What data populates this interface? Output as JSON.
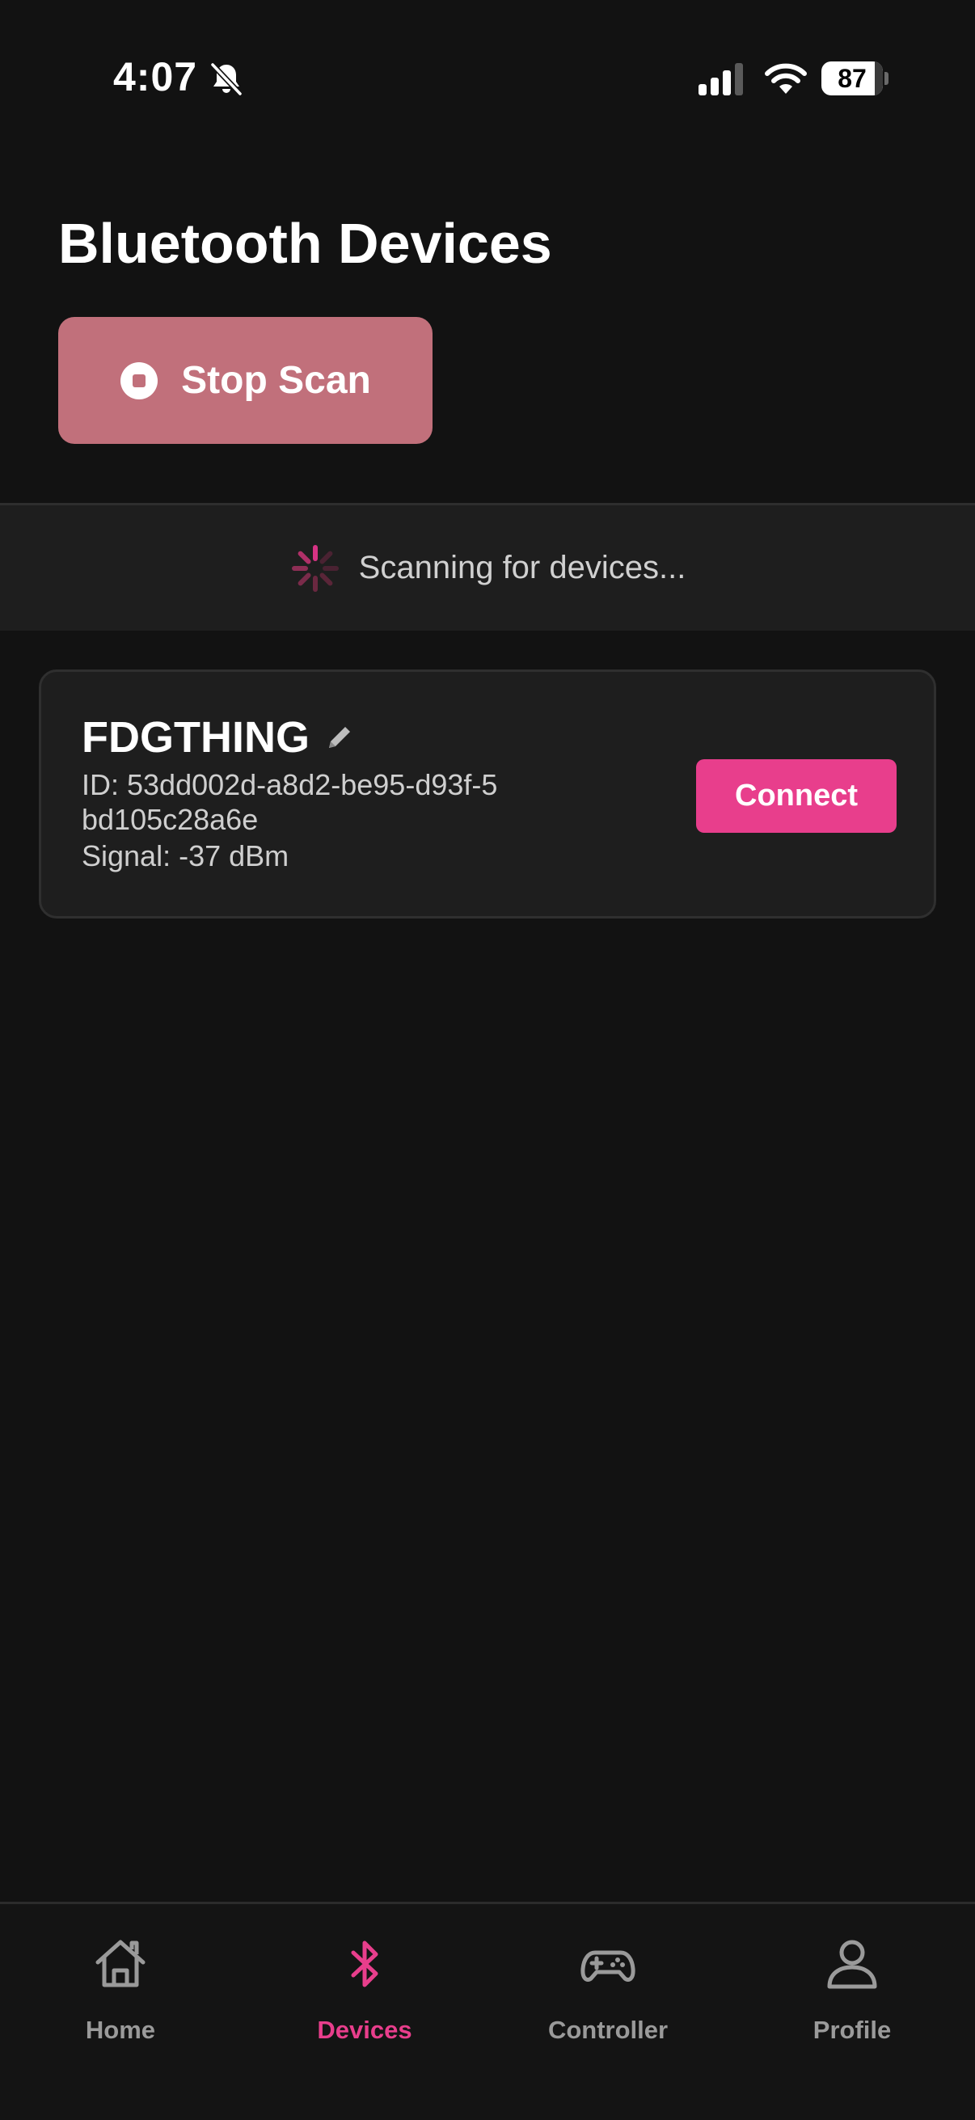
{
  "status_bar": {
    "time": "4:07",
    "battery_level": "87",
    "icons": [
      "bell-slash-icon",
      "cellular-signal-icon",
      "wifi-icon",
      "battery-icon"
    ]
  },
  "header": {
    "title": "Bluetooth Devices"
  },
  "scan_button": {
    "label": "Stop Scan",
    "icon": "stop-circle-icon",
    "color": "#c1707b"
  },
  "scan_status": {
    "text": "Scanning for devices...",
    "icon": "spinner-icon"
  },
  "devices": [
    {
      "name": "FDGTHING",
      "id_text": "ID: 53dd002d-a8d2-be95-d93f-5bd105c28a6e",
      "signal_text": "Signal: -37 dBm",
      "action_label": "Connect",
      "edit_icon": "pencil-icon"
    }
  ],
  "tab_bar": {
    "accent_color": "#e83e8c",
    "inactive_color": "#9a9a9a",
    "tabs": [
      {
        "label": "Home",
        "icon": "home-icon",
        "active": false
      },
      {
        "label": "Devices",
        "icon": "bluetooth-icon",
        "active": true
      },
      {
        "label": "Controller",
        "icon": "gamepad-icon",
        "active": false
      },
      {
        "label": "Profile",
        "icon": "user-icon",
        "active": false
      }
    ]
  }
}
